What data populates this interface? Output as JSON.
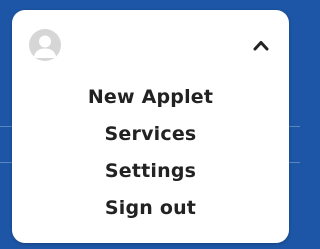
{
  "colors": {
    "background": "#1d56a6",
    "panel": "#ffffff",
    "text": "#222222",
    "avatar": "#d6d6d6"
  },
  "header": {
    "avatar_icon": "user-avatar-icon",
    "collapse_icon": "chevron-up-icon"
  },
  "menu": {
    "items": [
      {
        "label": "New Applet"
      },
      {
        "label": "Services"
      },
      {
        "label": "Settings"
      },
      {
        "label": "Sign out"
      }
    ]
  }
}
